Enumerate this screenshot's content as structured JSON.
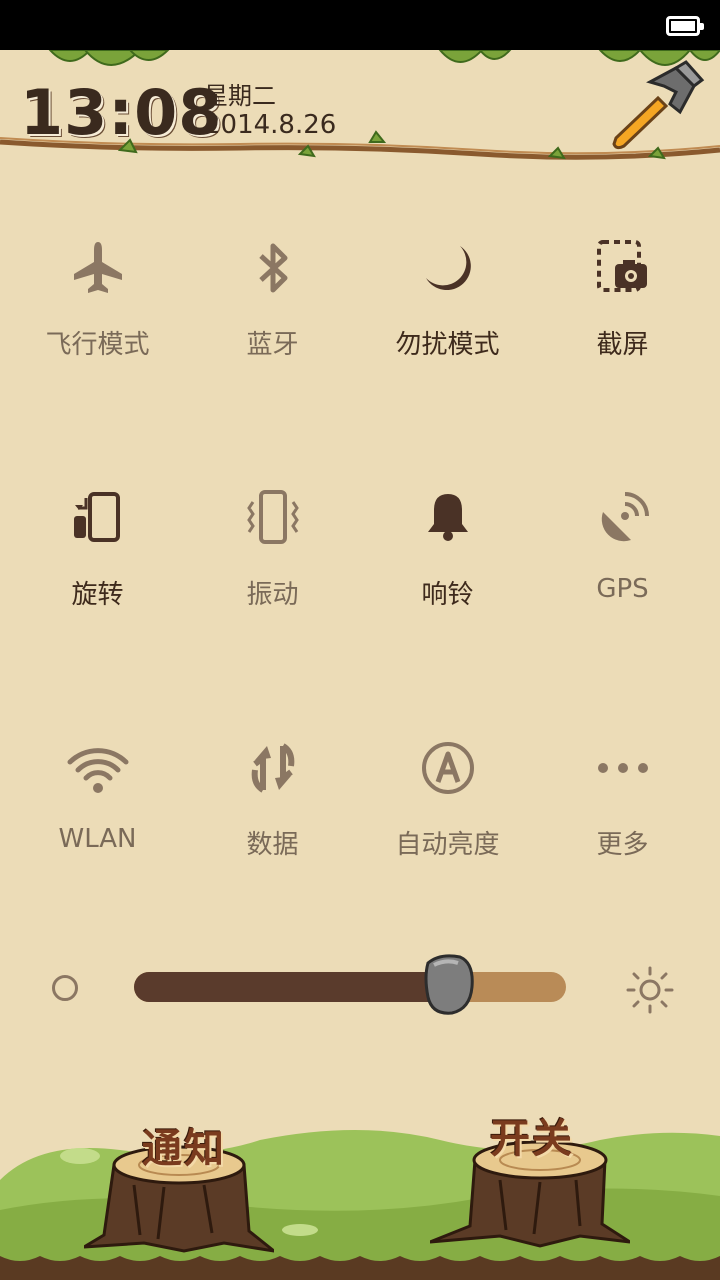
{
  "status_bar": {
    "battery_icon": "battery-full-icon"
  },
  "header": {
    "time": "13:08",
    "weekday": "星期二",
    "date": "2014.8.26",
    "settings_icon": "hammer-icon"
  },
  "toggles": [
    {
      "label": "飞行模式",
      "icon": "airplane-icon",
      "on": false
    },
    {
      "label": "蓝牙",
      "icon": "bluetooth-icon",
      "on": false
    },
    {
      "label": "勿扰模式",
      "icon": "moon-icon",
      "on": true
    },
    {
      "label": "截屏",
      "icon": "screenshot-icon",
      "on": true
    },
    {
      "label": "旋转",
      "icon": "rotate-icon",
      "on": true
    },
    {
      "label": "振动",
      "icon": "vibrate-icon",
      "on": false
    },
    {
      "label": "响铃",
      "icon": "bell-icon",
      "on": true
    },
    {
      "label": "GPS",
      "icon": "gps-icon",
      "on": false
    },
    {
      "label": "WLAN",
      "icon": "wifi-icon",
      "on": false
    },
    {
      "label": "数据",
      "icon": "data-icon",
      "on": false
    },
    {
      "label": "自动亮度",
      "icon": "auto-brightness-icon",
      "on": false
    },
    {
      "label": "更多",
      "icon": "more-icon",
      "on": false
    }
  ],
  "brightness": {
    "level_percent": 73
  },
  "bottom": {
    "notify_label": "通知",
    "switch_label": "开关"
  },
  "colors": {
    "background": "#ecdcb7",
    "active": "#4a3226",
    "inactive": "#8b7763",
    "slider_fill": "#5a3b2c",
    "slider_track": "#b98b57"
  }
}
